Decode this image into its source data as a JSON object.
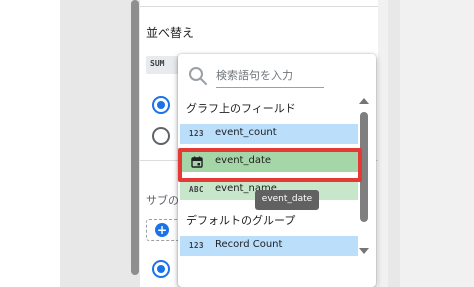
{
  "sort_section": {
    "title": "並べ替え",
    "metric_chip": "SUM"
  },
  "secondary_section": {
    "title": "サブの"
  },
  "dropdown": {
    "search_placeholder": "検索語句を入力",
    "chart_fields_heading": "グラフ上のフィールド",
    "chart_fields": [
      {
        "type": "123",
        "label": "event_count",
        "color": "#bbdefb"
      },
      {
        "type": "calendar-icon",
        "label": "event_date",
        "color": "#a5d6a7",
        "selected": true
      },
      {
        "type": "ABC",
        "label": "event_name",
        "color": "#c8e6c9"
      }
    ],
    "default_group_heading": "デフォルトのグループ",
    "default_fields": [
      {
        "type": "123",
        "label": "Record Count",
        "color": "#bbdefb"
      }
    ]
  },
  "tooltip": {
    "text": "event_date"
  },
  "colors": {
    "accent": "#1a73e8",
    "highlight_border": "#e53935"
  }
}
